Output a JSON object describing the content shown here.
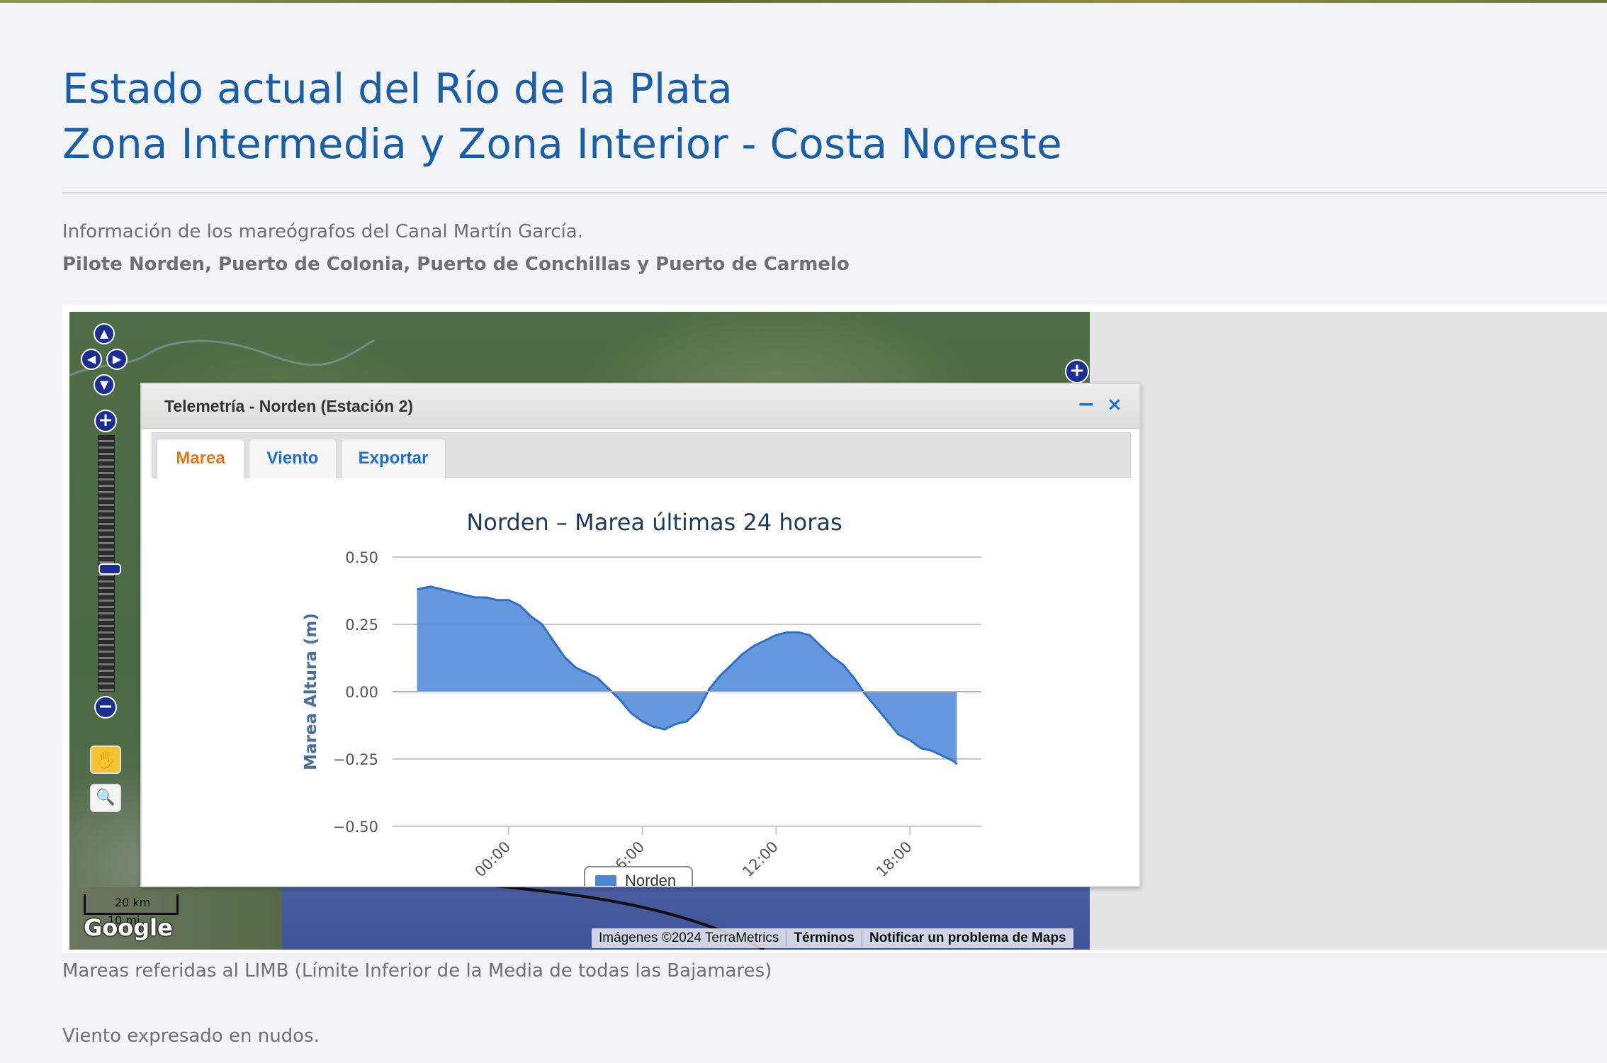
{
  "page": {
    "title_line1": "Estado actual del Río de la Plata",
    "title_line2": "Zona Intermedia y Zona Interior - Costa Noreste",
    "intro": "Información de los mareógrafos del Canal Martín García.",
    "intro_bold": "Pilote Norden, Puerto de Colonia, Puerto de Conchillas y Puerto de Carmelo",
    "note_limb": "Mareas referidas al LIMB (Límite Inferior de la Media de todas las Bajamares)",
    "note_wind": "Viento expresado en nudos."
  },
  "map": {
    "scale_km": "20 km",
    "scale_mi": "10 mi",
    "logo": "Google",
    "attribution_imagery": "Imágenes ©2024 TerraMetrics",
    "attribution_terms": "Términos",
    "attribution_report": "Notificar un problema de Maps",
    "icons": {
      "pan_up": "▲",
      "pan_left": "◀",
      "pan_right": "▶",
      "pan_down": "▼",
      "zoom_in": "+",
      "zoom_out": "−",
      "expand": "+",
      "hand": "✋",
      "zoom_box": "🔍"
    }
  },
  "window": {
    "title": "Telemetría - Norden (Estación 2)",
    "minimize": "−",
    "close": "×",
    "tabs": [
      {
        "label": "Marea",
        "active": true
      },
      {
        "label": "Viento",
        "active": false
      },
      {
        "label": "Exportar",
        "active": false
      }
    ]
  },
  "chart_data": {
    "type": "area",
    "title": "Norden – Marea últimas 24 horas",
    "xlabel": "",
    "ylabel": "Marea Altura (m)",
    "ylim": [
      -0.5,
      0.5
    ],
    "yticks": [
      "0.50",
      "0.25",
      "0.00",
      "−0.25",
      "−0.50"
    ],
    "xticks": [
      "00:00",
      "06:00",
      "12:00",
      "18:00"
    ],
    "x_hours": [
      -4.1,
      -3.5,
      -3,
      -2.5,
      -2,
      -1.5,
      -1,
      -0.5,
      0,
      0.5,
      1,
      1.5,
      2,
      2.5,
      3,
      3.5,
      4,
      4.5,
      5,
      5.5,
      6,
      6.5,
      7,
      7.5,
      8,
      8.5,
      9,
      9.5,
      10,
      10.5,
      11,
      11.5,
      12,
      12.5,
      13,
      13.5,
      14,
      14.5,
      15,
      15.5,
      16,
      16.5,
      17,
      17.5,
      18,
      18.5,
      19,
      19.5,
      20,
      20.1
    ],
    "series": [
      {
        "name": "Norden",
        "color": "#4a86d6",
        "values": [
          0.38,
          0.39,
          0.38,
          0.37,
          0.36,
          0.35,
          0.35,
          0.34,
          0.34,
          0.32,
          0.28,
          0.25,
          0.19,
          0.13,
          0.09,
          0.07,
          0.05,
          0.01,
          -0.03,
          -0.08,
          -0.11,
          -0.13,
          -0.14,
          -0.12,
          -0.11,
          -0.07,
          0.01,
          0.06,
          0.1,
          0.14,
          0.17,
          0.19,
          0.21,
          0.22,
          0.22,
          0.21,
          0.17,
          0.13,
          0.1,
          0.05,
          -0.01,
          -0.06,
          -0.11,
          -0.16,
          -0.18,
          -0.21,
          -0.22,
          -0.24,
          -0.26,
          -0.27
        ]
      }
    ],
    "legend_position": "bottom",
    "grid": true
  }
}
